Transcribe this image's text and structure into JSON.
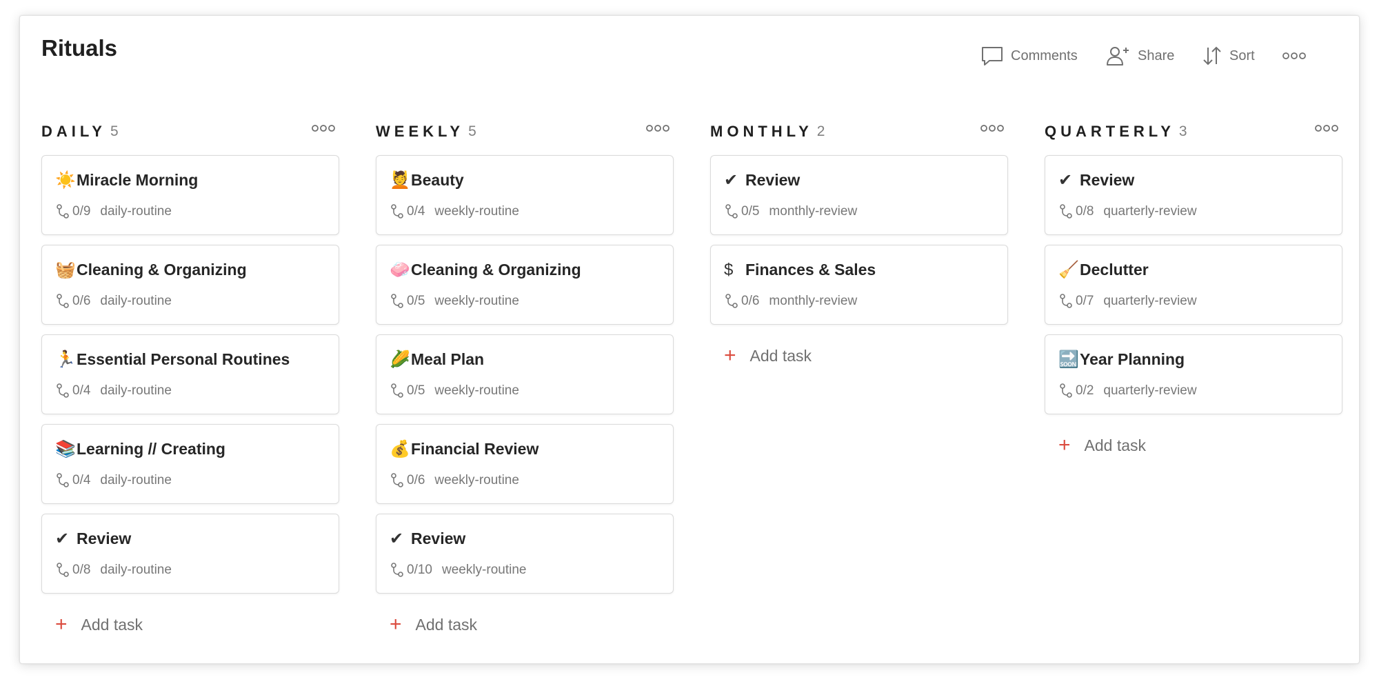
{
  "page": {
    "title": "Rituals"
  },
  "toolbar": {
    "comments_label": "Comments",
    "share_label": "Share",
    "sort_label": "Sort"
  },
  "add_task_label": "Add task",
  "accent_color": "#db4c3f",
  "columns": [
    {
      "title": "DAILY",
      "count": "5",
      "cards": [
        {
          "emoji": "☀️",
          "title": "Miracle Morning",
          "progress": "0/9",
          "label": "daily-routine"
        },
        {
          "emoji": "🧺",
          "title": "Cleaning & Organizing",
          "progress": "0/6",
          "label": "daily-routine"
        },
        {
          "emoji": "🏃",
          "title": "Essential Personal Routines",
          "progress": "0/4",
          "label": "daily-routine"
        },
        {
          "emoji": "📚",
          "title": "Learning // Creating",
          "progress": "0/4",
          "label": "daily-routine"
        },
        {
          "emoji": "✔",
          "title": "Review",
          "progress": "0/8",
          "label": "daily-routine"
        }
      ]
    },
    {
      "title": "WEEKLY",
      "count": "5",
      "cards": [
        {
          "emoji": "💆",
          "title": "Beauty",
          "progress": "0/4",
          "label": "weekly-routine"
        },
        {
          "emoji": "🧼",
          "title": "Cleaning & Organizing",
          "progress": "0/5",
          "label": "weekly-routine"
        },
        {
          "emoji": "🌽",
          "title": "Meal Plan",
          "progress": "0/5",
          "label": "weekly-routine"
        },
        {
          "emoji": "💰",
          "title": "Financial Review",
          "progress": "0/6",
          "label": "weekly-routine"
        },
        {
          "emoji": "✔",
          "title": "Review",
          "progress": "0/10",
          "label": "weekly-routine"
        }
      ]
    },
    {
      "title": "MONTHLY",
      "count": "2",
      "cards": [
        {
          "emoji": "✔",
          "title": "Review",
          "progress": "0/5",
          "label": "monthly-review"
        },
        {
          "emoji": "$",
          "title": "Finances & Sales",
          "progress": "0/6",
          "label": "monthly-review"
        }
      ]
    },
    {
      "title": "QUARTERLY",
      "count": "3",
      "cards": [
        {
          "emoji": "✔",
          "title": "Review",
          "progress": "0/8",
          "label": "quarterly-review"
        },
        {
          "emoji": "🧹",
          "title": "Declutter",
          "progress": "0/7",
          "label": "quarterly-review"
        },
        {
          "emoji": "🔜",
          "title": "Year Planning",
          "progress": "0/2",
          "label": "quarterly-review"
        }
      ]
    }
  ]
}
